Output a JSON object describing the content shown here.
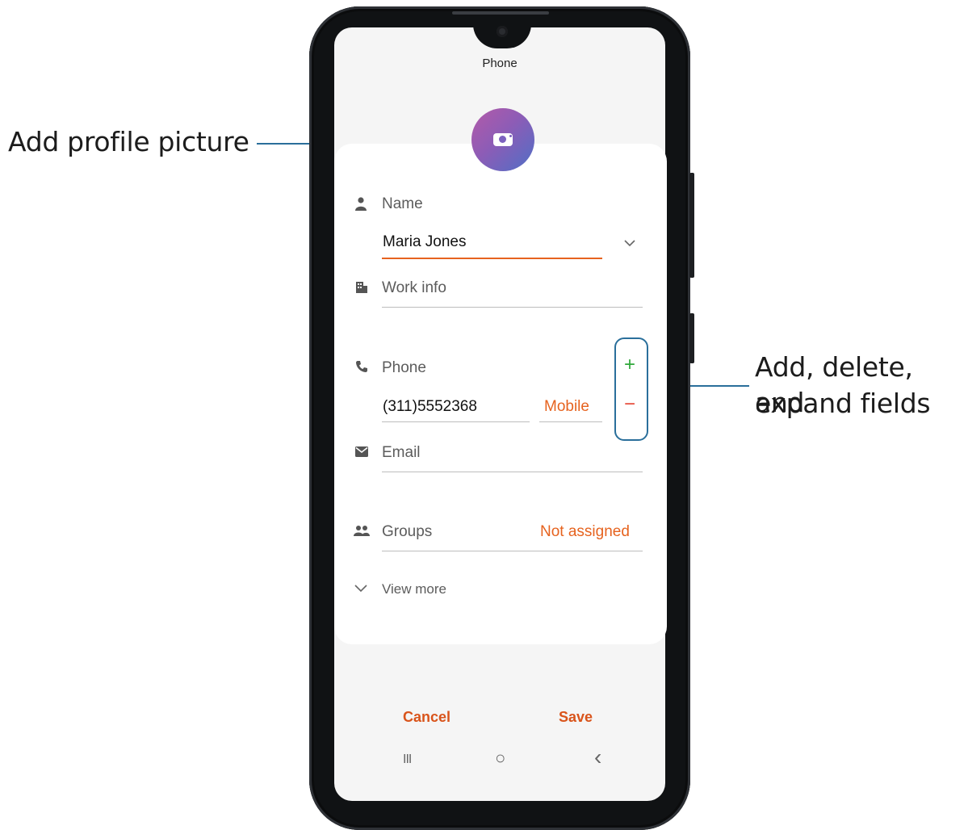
{
  "callouts": {
    "profile": "Add profile picture",
    "fields_line1": "Add, delete, and",
    "fields_line2": "expand fields"
  },
  "header": {
    "title": "Phone"
  },
  "form": {
    "name_label": "Name",
    "name_value": "Maria Jones",
    "work_label": "Work info",
    "phone_label": "Phone",
    "phone_value": "(311)5552368",
    "phone_type": "Mobile",
    "email_label": "Email",
    "groups_label": "Groups",
    "groups_value": "Not assigned",
    "view_more": "View more"
  },
  "actions": {
    "cancel": "Cancel",
    "save": "Save"
  },
  "field_buttons": {
    "add": "+",
    "remove": "−"
  },
  "nav": {
    "recents": "III",
    "home": "○",
    "back": "‹"
  },
  "colors": {
    "accent": "#e6631f",
    "add": "#2fa83a",
    "remove": "#e64a3a",
    "callout_line": "#2a6f9b"
  }
}
